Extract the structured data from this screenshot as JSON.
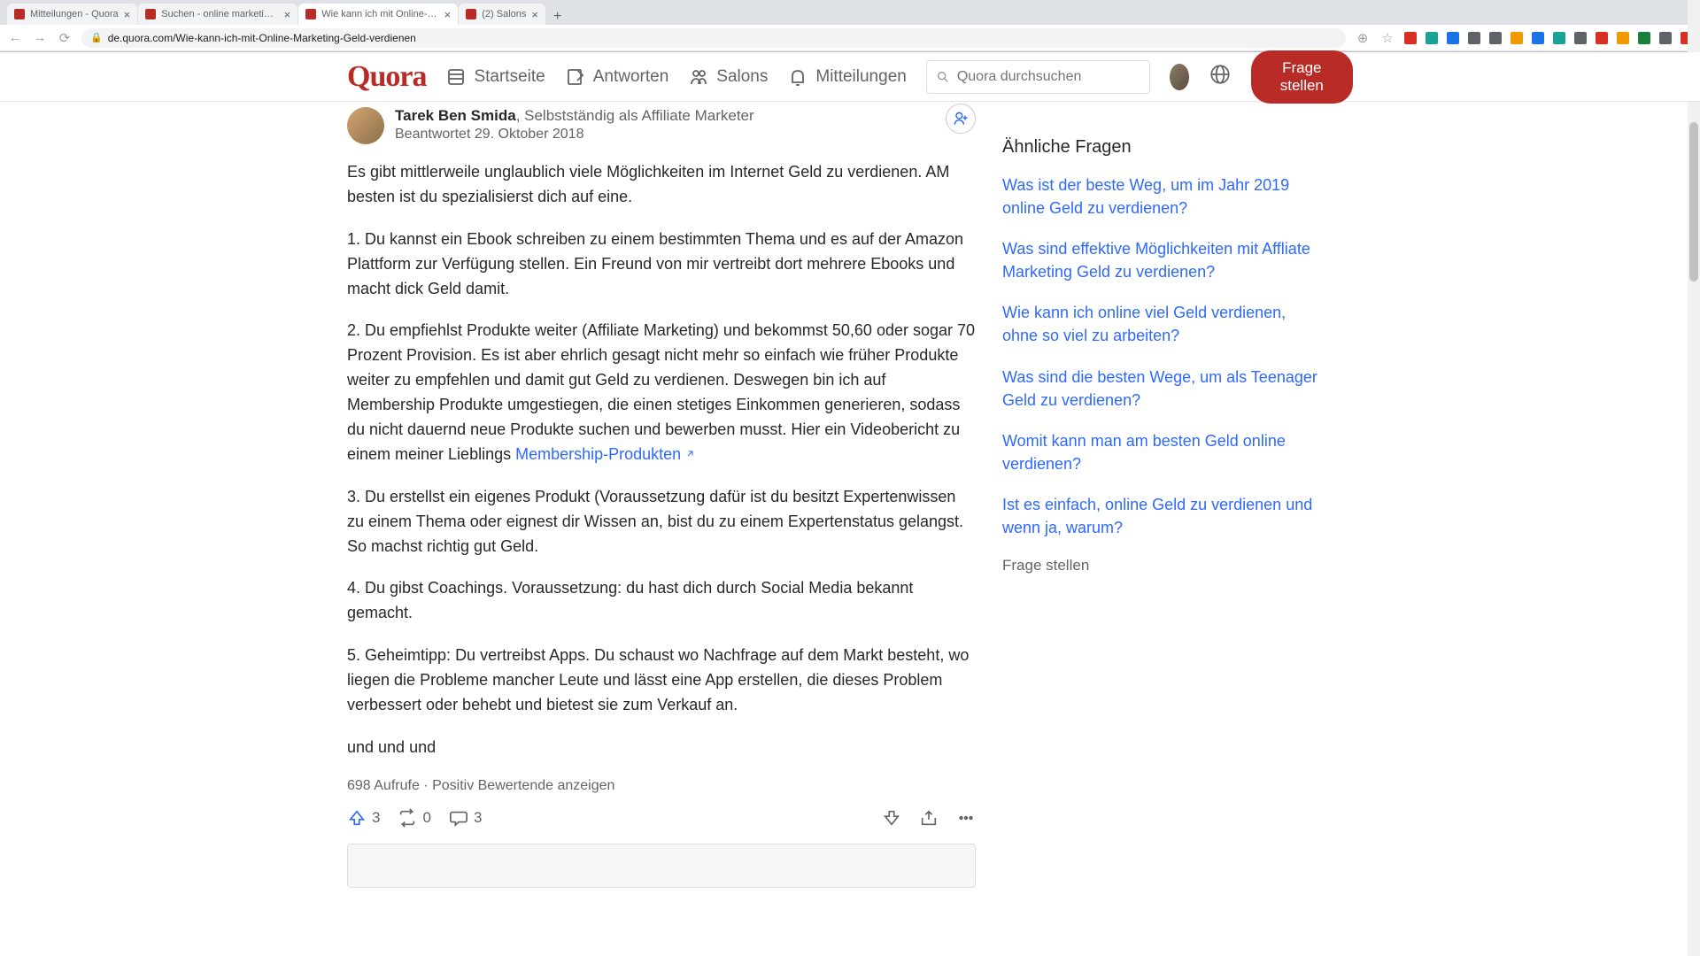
{
  "browser": {
    "tabs": [
      {
        "title": "Mitteilungen - Quora",
        "active": false
      },
      {
        "title": "Suchen - online marketing - G",
        "active": false
      },
      {
        "title": "Wie kann ich mit Online-Mark",
        "active": true
      },
      {
        "title": "(2) Salons",
        "active": false
      }
    ],
    "url": "de.quora.com/Wie-kann-ich-mit-Online-Marketing-Geld-verdienen"
  },
  "header": {
    "logo": "Quora",
    "nav": {
      "home": "Startseite",
      "answer": "Antworten",
      "spaces": "Salons",
      "notifications": "Mitteilungen"
    },
    "search_placeholder": "Quora durchsuchen",
    "ask_label": "Frage stellen"
  },
  "answer": {
    "author_name": "Tarek Ben Smida",
    "author_credential": ", Selbstständig als Affiliate Marketer",
    "date": "Beantwortet 29. Oktober 2018",
    "p_intro": "Es gibt mittlerweile unglaublich viele Möglichkeiten im Internet Geld zu verdienen. AM besten ist du spezialisierst dich auf eine.",
    "p1": "1. Du kannst ein Ebook schreiben zu einem bestimmten Thema und es auf der Amazon Plattform zur Verfügung stellen. Ein Freund von mir vertreibt dort mehrere Ebooks und macht dick Geld damit.",
    "p2_before_link": "2. Du empfiehlst Produkte weiter (Affiliate Marketing) und bekommst 50,60 oder sogar 70 Prozent Provision. Es ist aber ehrlich gesagt nicht mehr so einfach wie früher Produkte weiter zu empfehlen und damit gut Geld zu verdienen. Deswegen bin ich auf Membership Produkte umgestiegen, die einen stetiges Einkommen generieren, sodass du nicht dauernd neue Produkte suchen und bewerben musst. Hier ein Videobericht zu einem meiner Lieblings ",
    "p2_link": "Membership-Produkten",
    "p3": "3. Du erstellst ein eigenes Produkt (Voraussetzung dafür ist du besitzt Expertenwissen zu einem Thema oder eignest dir Wissen an, bist du zu einem Expertenstatus gelangst. So machst richtig gut Geld.",
    "p4": "4. Du gibst Coachings. Voraussetzung: du hast dich durch Social Media bekannt gemacht.",
    "p5": "5. Geheimtipp: Du vertreibst Apps. Du schaust wo Nachfrage auf dem Markt besteht, wo liegen die Probleme mancher Leute und lässt eine App erstellen, die dieses Problem verbessert oder behebt und bietest sie zum Verkauf an.",
    "p_outro": "und und und",
    "stats_views": "698 Aufrufe",
    "stats_sep": " · ",
    "stats_upvoters": "Positiv Bewertende anzeigen",
    "upvote_count": "3",
    "share_count": "0",
    "comment_count": "3"
  },
  "sidebar": {
    "title": "Ähnliche Fragen",
    "q1": "Was ist der beste Weg, um im Jahr 2019 online Geld zu verdienen?",
    "q2": "Was sind effektive Möglichkeiten mit Affliate Marketing Geld zu verdienen?",
    "q3": "Wie kann ich online viel Geld verdienen, ohne so viel zu arbeiten?",
    "q4": "Was sind die besten Wege, um als Teenager Geld zu verdienen?",
    "q5": "Womit kann man am besten Geld online verdienen?",
    "q6": "Ist es einfach, online Geld zu verdienen und wenn ja, warum?",
    "ask": "Frage stellen"
  }
}
